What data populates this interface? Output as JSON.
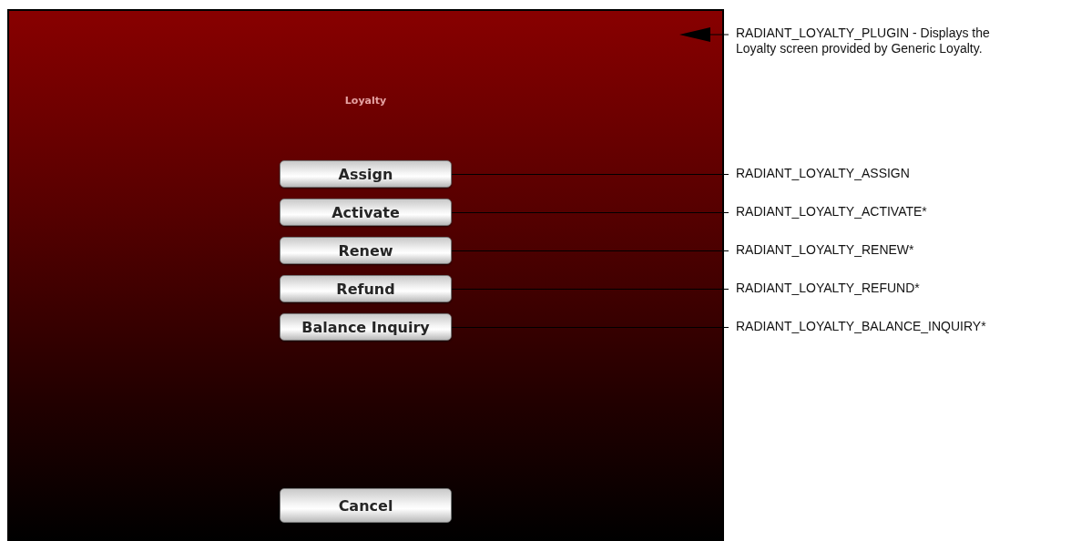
{
  "screen": {
    "title": "Loyalty",
    "buttons": [
      {
        "label": "Assign",
        "note": "RADIANT_LOYALTY_ASSIGN"
      },
      {
        "label": "Activate",
        "note": "RADIANT_LOYALTY_ACTIVATE*"
      },
      {
        "label": "Renew",
        "note": "RADIANT_LOYALTY_RENEW*"
      },
      {
        "label": "Refund",
        "note": "RADIANT_LOYALTY_REFUND*"
      },
      {
        "label": "Balance Inquiry",
        "note": "RADIANT_LOYALTY_BALANCE_INQUIRY*"
      }
    ],
    "cancel": {
      "label": "Cancel"
    }
  },
  "plugin_note": "RADIANT_LOYALTY_PLUGIN - Displays the Loyalty screen provided by Generic Loyalty."
}
